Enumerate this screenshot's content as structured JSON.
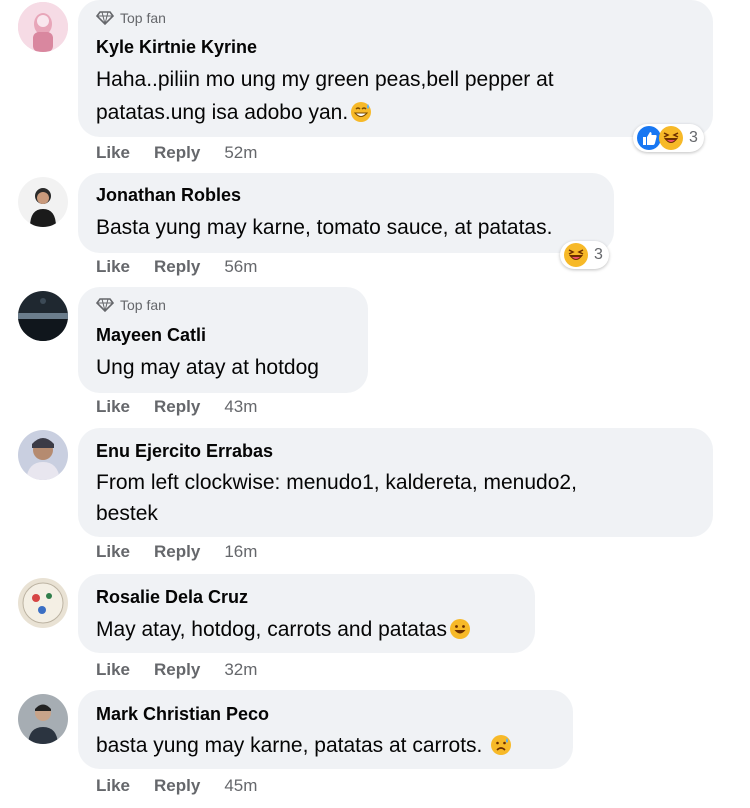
{
  "comments": [
    {
      "badge": "Top fan",
      "author": "Kyle Kirtnie Kyrine",
      "lines": [
        "Haha..piliin mo ung my green peas,bell pepper at",
        "patatas.ung isa adobo yan."
      ],
      "like": "Like",
      "reply": "Reply",
      "time": "52m",
      "reactions": [
        "like",
        "haha"
      ],
      "reaction_count": "3"
    },
    {
      "author": "Jonathan Robles",
      "lines": [
        "Basta yung may karne, tomato sauce, at patatas."
      ],
      "like": "Like",
      "reply": "Reply",
      "time": "56m",
      "reactions": [
        "haha"
      ],
      "reaction_count": "3"
    },
    {
      "badge": "Top fan",
      "author": "Mayeen Catli",
      "lines": [
        "Ung may atay at hotdog"
      ],
      "like": "Like",
      "reply": "Reply",
      "time": "43m"
    },
    {
      "author": "Enu Ejercito Errabas",
      "lines": [
        "From left clockwise: menudo1, kaldereta, menudo2,",
        "bestek"
      ],
      "like": "Like",
      "reply": "Reply",
      "time": "16m"
    },
    {
      "author": "Rosalie Dela Cruz",
      "lines": [
        "May atay, hotdog, carrots and patatas"
      ],
      "like": "Like",
      "reply": "Reply",
      "time": "32m"
    },
    {
      "author": "Mark Christian Peco",
      "lines": [
        "basta yung may karne, patatas at carrots. "
      ],
      "like": "Like",
      "reply": "Reply",
      "time": "45m"
    }
  ],
  "colors": {
    "bubble": "#f0f2f5",
    "muted": "#65676b",
    "like_blue": "#1877f2",
    "haha_yellow": "#f7b928"
  }
}
